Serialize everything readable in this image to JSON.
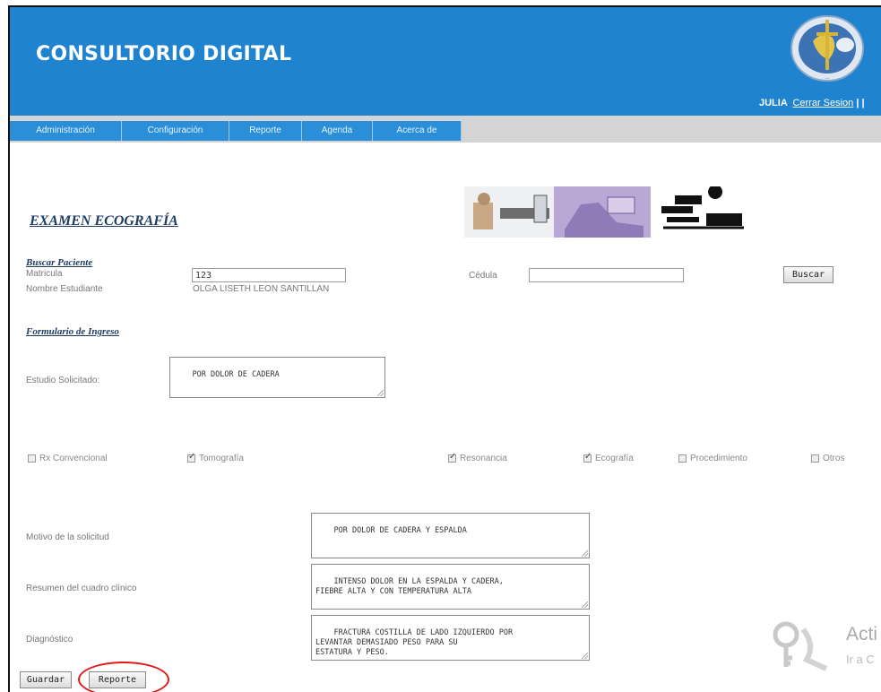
{
  "header": {
    "title": "CONSULTORIO DIGITAL",
    "user": "JULIA",
    "logout": "Cerrar Sesion",
    "separator": "| |"
  },
  "nav": [
    {
      "label": "Administración"
    },
    {
      "label": "Configuración"
    },
    {
      "label": "Reporte"
    },
    {
      "label": "Agenda"
    },
    {
      "label": "Acerca de"
    }
  ],
  "page": {
    "heading": "EXAMEN ECOGRAFÍA",
    "search_heading": "Buscar Paciente",
    "matricula_label": "Matricula",
    "matricula_value": "123",
    "nombre_label": "Nombre Estudiante",
    "nombre_value": "OLGA LISETH LEON SANTILLAN",
    "cedula_label": "Cédula",
    "cedula_value": "",
    "buscar_button": "Buscar",
    "form_heading": "Formulario de Ingreso",
    "estudio_label": "Estudio Solicitado:",
    "estudio_value": "POR DOLOR DE CADERA",
    "motivo_label": "Motivo de la solicitud",
    "motivo_value": "POR DOLOR DE CADERA Y ESPALDA",
    "resumen_label": "Resumen del cuadro clínico",
    "resumen_value": "INTENSO DOLOR EN LA ESPALDA Y CADERA,\nFIEBRE ALTA Y CON TEMPERATURA ALTA",
    "diagnostico_label": "Diagnóstico",
    "diagnostico_value": "FRACTURA COSTILLA DE LADO IZQUIERDO POR\nLEVANTAR DEMASIADO PESO PARA SU\nESTATURA Y PESO.",
    "guardar_button": "Guardar",
    "reporte_button": "Reporte"
  },
  "checks": [
    {
      "label": "Rx Convencional",
      "checked": false
    },
    {
      "label": "Tomografía",
      "checked": true
    },
    {
      "label": "Resonancia",
      "checked": true
    },
    {
      "label": "Ecografía",
      "checked": true
    },
    {
      "label": "Procedimiento",
      "checked": false
    },
    {
      "label": "Otros",
      "checked": false
    }
  ],
  "watermark": {
    "line1": "Acti",
    "line2": "Ir a C"
  },
  "colors": {
    "header_blue": "#1f83cf",
    "nav_blue": "#2a8fd8",
    "heading_navy": "#1f3d63",
    "highlight_red": "#e01818"
  }
}
